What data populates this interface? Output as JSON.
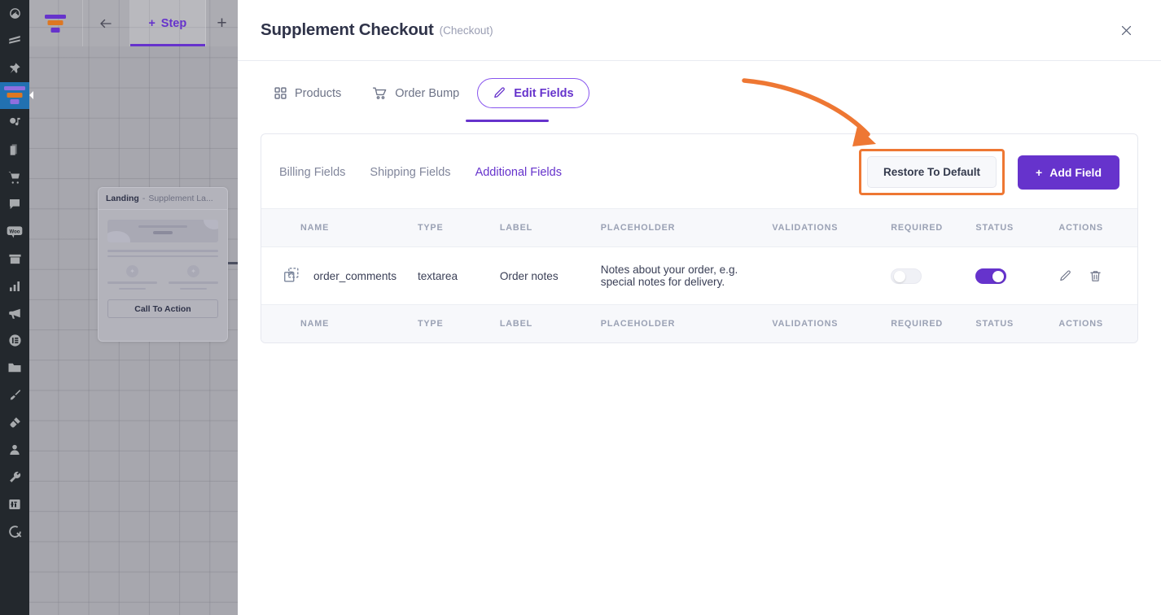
{
  "wp_sidebar": {
    "items": [
      {
        "name": "dashboard",
        "icon": "gauge-icon"
      },
      {
        "name": "layers",
        "icon": "layers-icon"
      },
      {
        "name": "pin",
        "icon": "pin-icon"
      },
      {
        "name": "funnels",
        "icon": "funnel-icon",
        "active": true
      },
      {
        "name": "media",
        "icon": "media-icon"
      },
      {
        "name": "pages",
        "icon": "pages-icon"
      },
      {
        "name": "products",
        "icon": "cart-icon"
      },
      {
        "name": "comments",
        "icon": "comment-icon"
      },
      {
        "name": "woocommerce",
        "icon": "woo-icon"
      },
      {
        "name": "archive",
        "icon": "archive-icon"
      },
      {
        "name": "analytics",
        "icon": "bar-chart-icon"
      },
      {
        "name": "marketing",
        "icon": "megaphone-icon"
      },
      {
        "name": "elementor",
        "icon": "elementor-icon"
      },
      {
        "name": "files",
        "icon": "folder-icon"
      },
      {
        "name": "appearance",
        "icon": "brush-icon"
      },
      {
        "name": "plugins",
        "icon": "plug-icon"
      },
      {
        "name": "users",
        "icon": "user-icon"
      },
      {
        "name": "tools",
        "icon": "wrench-icon"
      },
      {
        "name": "settings",
        "icon": "sliders-icon"
      },
      {
        "name": "quform",
        "icon": "q-logo-icon"
      }
    ]
  },
  "topbar": {
    "logo_name": "funnel-logo",
    "back_label": "←",
    "step_label": "Step",
    "step_plus": "+",
    "add_label": "+"
  },
  "step_card": {
    "type_label": "Landing",
    "separator": "-",
    "name": "Supplement La...",
    "cta_label": "Call To Action"
  },
  "modal": {
    "title": "Supplement Checkout",
    "subtitle": "(Checkout)",
    "close_label": "✕",
    "tabs": [
      {
        "label": "Products",
        "icon": "grid-icon",
        "active": false
      },
      {
        "label": "Order Bump",
        "icon": "cart-icon",
        "active": false
      },
      {
        "label": "Edit Fields",
        "icon": "pencil-icon",
        "active": true
      }
    ],
    "subtabs": [
      {
        "label": "Billing Fields",
        "active": false
      },
      {
        "label": "Shipping Fields",
        "active": false
      },
      {
        "label": "Additional Fields",
        "active": true
      }
    ],
    "restore_label": "Restore To Default",
    "add_field_label": "Add Field",
    "add_field_plus": "+",
    "table": {
      "headers": [
        "NAME",
        "TYPE",
        "LABEL",
        "PLACEHOLDER",
        "VALIDATIONS",
        "REQUIRED",
        "STATUS",
        "ACTIONS"
      ],
      "rows": [
        {
          "drag_icon": "move-icon",
          "name": "order_comments",
          "type": "textarea",
          "label": "Order notes",
          "placeholder": "Notes about your order, e.g. special notes for delivery.",
          "validations": "",
          "required": false,
          "status": true,
          "edit_icon": "pencil-icon",
          "delete_icon": "trash-icon"
        }
      ]
    }
  },
  "annotation": {
    "type": "curved-arrow",
    "color": "#ee7733",
    "points_to": "restore-to-default-button",
    "highlight_color": "#ee7733"
  },
  "colors": {
    "accent": "#6633cc",
    "accent_light": "#8855ee",
    "annotation": "#ee7733",
    "sidebar_bg": "#23282d",
    "canvas": "#a7a7ae",
    "text_dark": "#2f3349",
    "text_muted": "#9aa1b4"
  }
}
